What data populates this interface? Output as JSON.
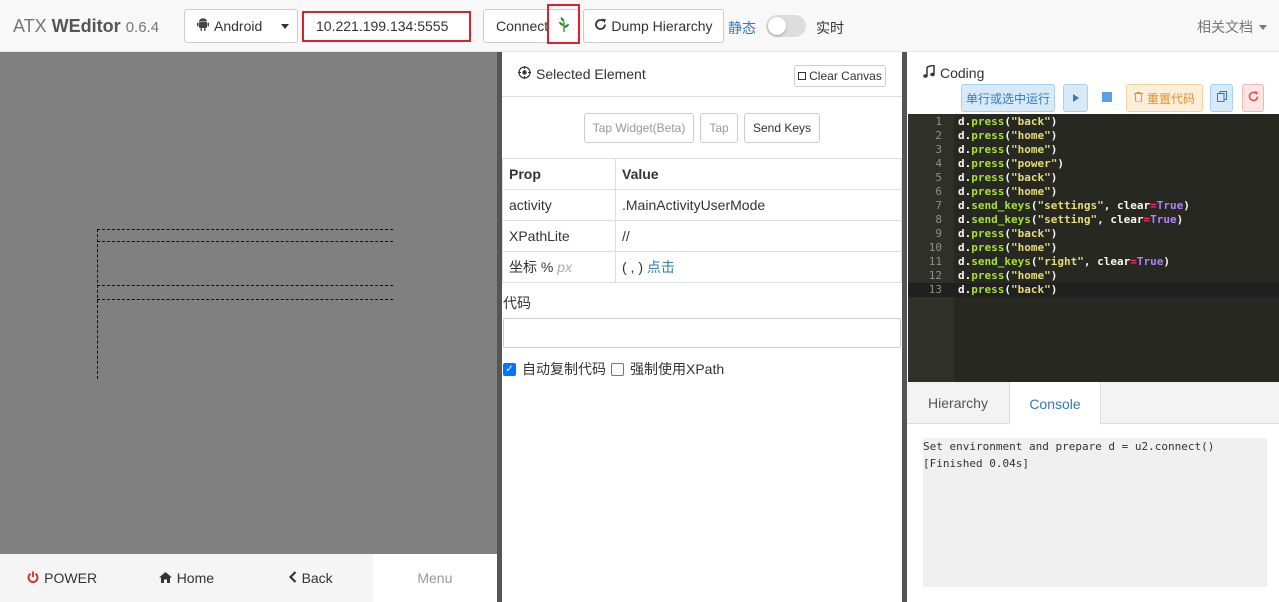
{
  "app": {
    "name_prefix": "ATX ",
    "name_bold": "WEditor",
    "version": "0.6.4"
  },
  "toolbar": {
    "platform": "Android",
    "device_address": "10.221.199.134:5555",
    "connect_label": "Connect",
    "dump_label": "Dump Hierarchy",
    "mode_static": "静态",
    "mode_live": "实时",
    "live_enabled": false,
    "docs_label": "相关文档"
  },
  "device_nav": {
    "power": "POWER",
    "home": "Home",
    "back": "Back",
    "menu": "Menu"
  },
  "selected": {
    "title": "Selected Element",
    "clear_canvas": "Clear Canvas",
    "tap_widget": "Tap Widget(Beta)",
    "tap": "Tap",
    "send_keys": "Send Keys",
    "col_prop": "Prop",
    "col_value": "Value",
    "rows": [
      {
        "prop": "activity",
        "value": ".MainActivityUserMode"
      },
      {
        "prop": "XPathLite",
        "value": "//"
      },
      {
        "prop": "坐标 %",
        "prop_unit": "px",
        "value": "( , )",
        "value_link": "点击"
      }
    ],
    "code_label": "代码",
    "code_value": "",
    "auto_copy_label": "自动复制代码",
    "auto_copy_checked": true,
    "force_xpath_label": "强制使用XPath",
    "force_xpath_checked": false
  },
  "coding": {
    "title": "Coding",
    "run_line": "单行或选中运行",
    "reset_code": "重置代码",
    "lines": [
      "d.press(\"back\")",
      "d.press(\"home\")",
      "d.press(\"home\")",
      "d.press(\"power\")",
      "d.press(\"back\")",
      "d.press(\"home\")",
      "d.send_keys(\"settings\", clear=True)",
      "d.send_keys(\"setting\", clear=True)",
      "d.press(\"back\")",
      "d.press(\"home\")",
      "d.send_keys(\"right\", clear=True)",
      "d.press(\"home\")",
      "d.press(\"back\")"
    ],
    "tabs": [
      "Hierarchy",
      "Console"
    ],
    "active_tab": "Console",
    "console": [
      "Set environment and prepare d = u2.connect()",
      "[Finished 0.04s]"
    ]
  },
  "icons": {
    "platform": "android-icon",
    "connected": "leaf-icon",
    "refresh": "refresh-icon",
    "selected": "crosshair-icon",
    "coding": "music-note-icon",
    "run": "play-icon",
    "stop": "stop-icon",
    "reset": "trash-icon",
    "copy": "copy-icon",
    "reload": "reload-icon",
    "power": "power-icon",
    "home": "home-icon",
    "back": "chevron-left-icon"
  },
  "colors": {
    "accent": "#337ab7",
    "highlight_red": "#d9232b",
    "device_bg": "#808080",
    "editor_bg": "#272822",
    "leaf_green": "#2e8b2e"
  }
}
